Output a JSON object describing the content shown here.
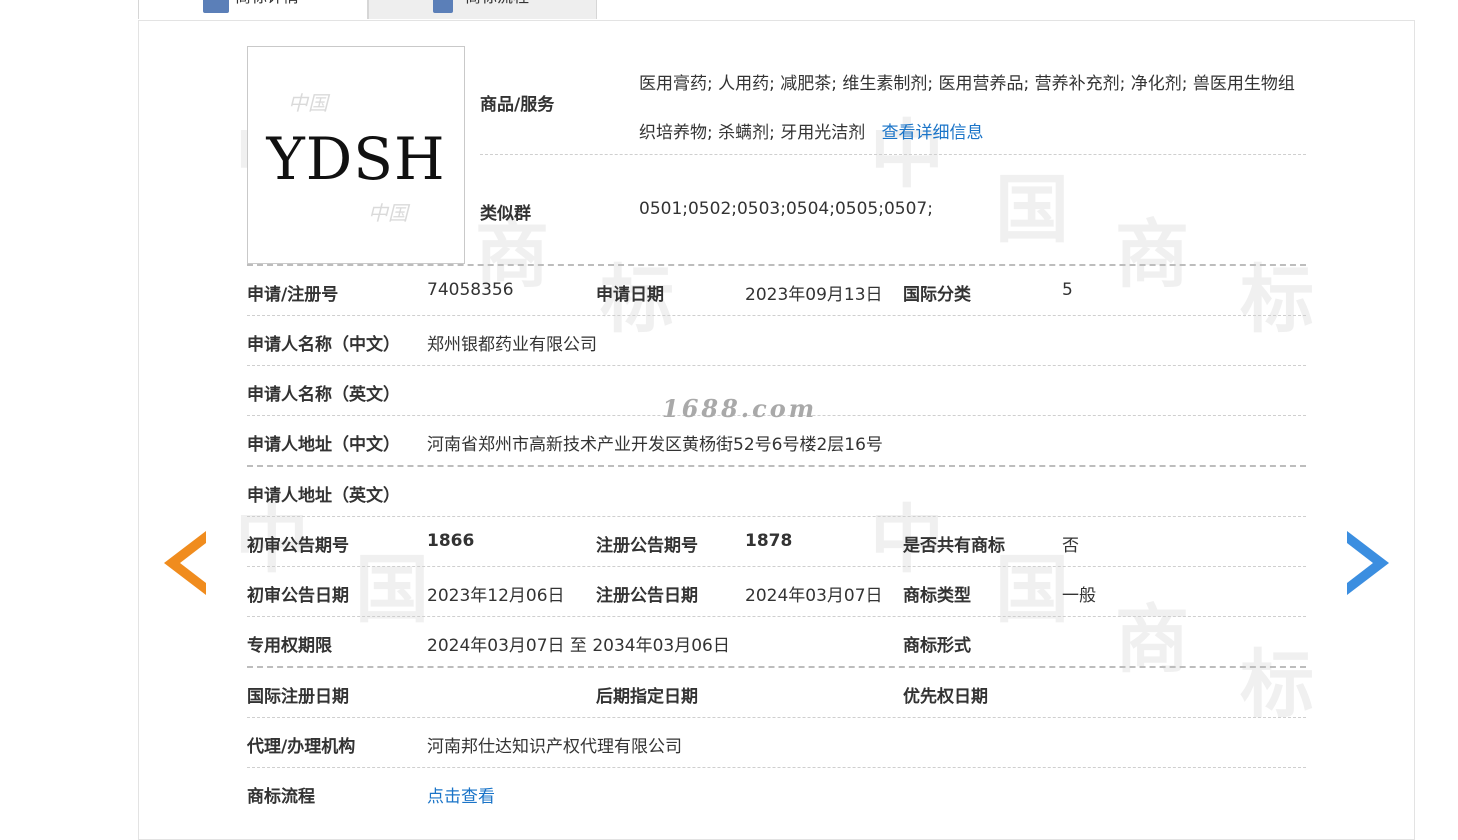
{
  "tabs": [
    {
      "label": "商标详情",
      "icon": "list-icon"
    },
    {
      "label": "商标流程",
      "icon": "flow-icon"
    }
  ],
  "watermark": {
    "site": "1688.com",
    "chars": [
      "中",
      "国",
      "商",
      "标"
    ]
  },
  "logo": {
    "text": "YDSH",
    "stamp_text": "中国"
  },
  "goods": {
    "label": "商品/服务",
    "value": "医用膏药; 人用药; 减肥茶; 维生素制剂; 医用营养品; 营养补充剂; 净化剂; 兽医用生物组织培养物; 杀螨剂; 牙用光洁剂",
    "more_link": "查看详细信息"
  },
  "similar": {
    "label": "类似群",
    "value": "0501;0502;0503;0504;0505;0507;"
  },
  "fields": {
    "reg_no_label": "申请/注册号",
    "reg_no": "74058356",
    "apply_date_label": "申请日期",
    "apply_date": "2023年09月13日",
    "intl_class_label": "国际分类",
    "intl_class": "5",
    "applicant_cn_label": "申请人名称（中文）",
    "applicant_cn": "郑州银都药业有限公司",
    "applicant_en_label": "申请人名称（英文）",
    "applicant_en": "",
    "address_cn_label": "申请人地址（中文）",
    "address_cn": "河南省郑州市高新技术产业开发区黄杨街52号6号楼2层16号",
    "address_en_label": "申请人地址（英文）",
    "address_en": "",
    "prelim_no_label": "初审公告期号",
    "prelim_no": "1866",
    "reg_pub_no_label": "注册公告期号",
    "reg_pub_no": "1878",
    "shared_label": "是否共有商标",
    "shared": "否",
    "prelim_date_label": "初审公告日期",
    "prelim_date": "2023年12月06日",
    "reg_pub_date_label": "注册公告日期",
    "reg_pub_date": "2024年03月07日",
    "tm_type_label": "商标类型",
    "tm_type": "一般",
    "exclusive_label": "专用权期限",
    "exclusive": "2024年03月07日 至 2034年03月06日",
    "tm_form_label": "商标形式",
    "tm_form": "",
    "intl_reg_date_label": "国际注册日期",
    "intl_reg_date": "",
    "later_date_label": "后期指定日期",
    "later_date": "",
    "priority_label": "优先权日期",
    "priority": "",
    "agent_label": "代理/办理机构",
    "agent": "河南邦仕达知识产权代理有限公司",
    "flow_label": "商标流程",
    "flow_link": "点击查看"
  },
  "colors": {
    "link": "#1a74c8",
    "arrow_prev": "#f08c1e",
    "arrow_next": "#3b8ee0"
  }
}
